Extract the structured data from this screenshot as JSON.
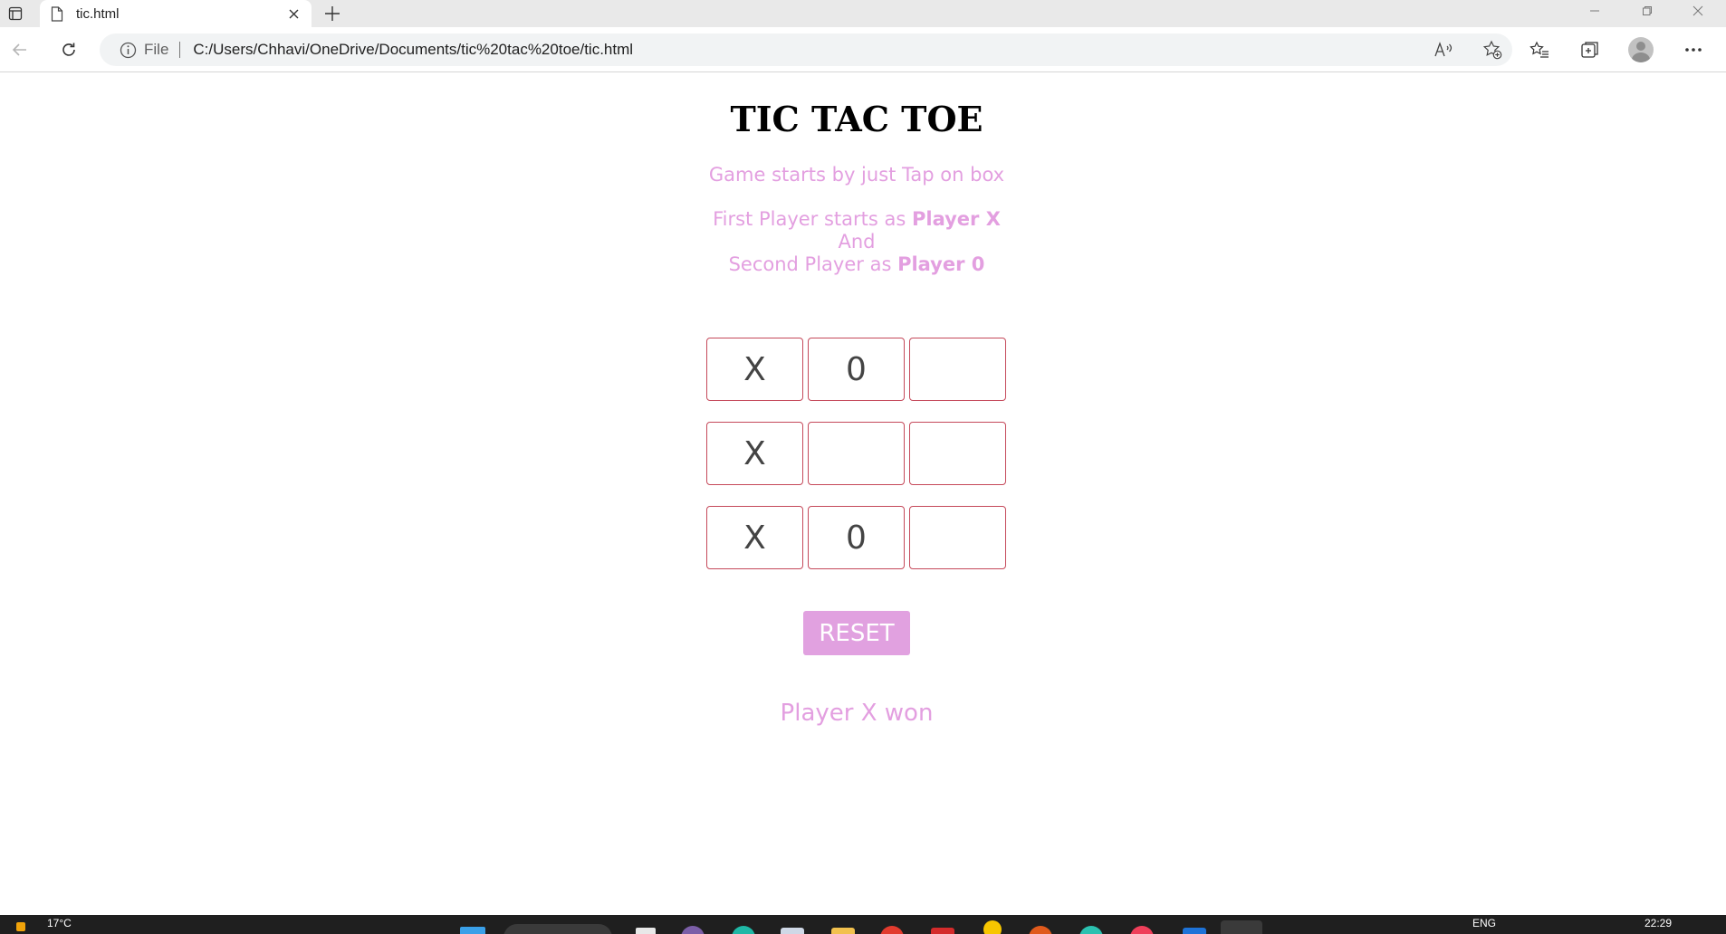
{
  "browser": {
    "tab_title": "tic.html",
    "address_prefix": "File",
    "url": "C:/Users/Chhavi/OneDrive/Documents/tic%20tac%20toe/tic.html"
  },
  "page": {
    "title": "TIC TAC TOE",
    "instruction": "Game starts by just Tap on box",
    "line1_prefix": "First Player starts as ",
    "line1_bold": "Player X",
    "line2": "And",
    "line3_prefix": "Second Player as ",
    "line3_bold": "Player 0",
    "board": [
      [
        "X",
        "0",
        ""
      ],
      [
        "X",
        "",
        ""
      ],
      [
        "X",
        "0",
        ""
      ]
    ],
    "reset_label": "RESET",
    "result": "Player X won"
  },
  "taskbar": {
    "weather": "17°C",
    "language": "ENG",
    "time": "22:29"
  },
  "colors": {
    "accent_pink": "#e39fe0",
    "button_pink": "#e1a1e0",
    "cell_border": "#c5495a"
  }
}
